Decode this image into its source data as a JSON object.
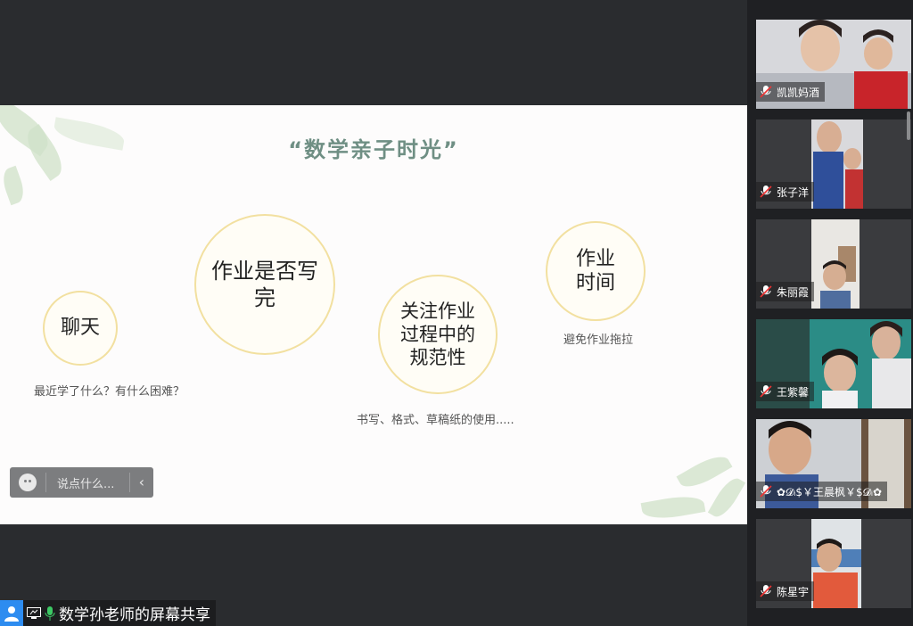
{
  "slide": {
    "title": "“数学亲子时光”",
    "circles": [
      {
        "text": "聊天",
        "caption": "最近学了什么？有什么困难？"
      },
      {
        "text": "作业是否写完",
        "caption": ""
      },
      {
        "text": "关注作业过程中的规范性",
        "caption": "书写、格式、草稿纸的使用....."
      },
      {
        "text": "作业时间",
        "caption": "避免作业拖拉"
      }
    ]
  },
  "chat": {
    "placeholder": "说点什么...",
    "collapse_glyph": "‹"
  },
  "share": {
    "label": "数学孙老师的屏幕共享"
  },
  "participants": [
    {
      "name": "凯凯妈酒"
    },
    {
      "name": "张子洋"
    },
    {
      "name": "朱丽霞"
    },
    {
      "name": "王紫馨"
    },
    {
      "name": "✿𝓓ᵢ$￥王晨枫￥$𝓓ᵢ✿"
    },
    {
      "name": "陈星宇"
    }
  ],
  "colors": {
    "accent": "#4aa37c",
    "circle_border": "#f2e0a0",
    "share_blue": "#2d8cf0"
  }
}
